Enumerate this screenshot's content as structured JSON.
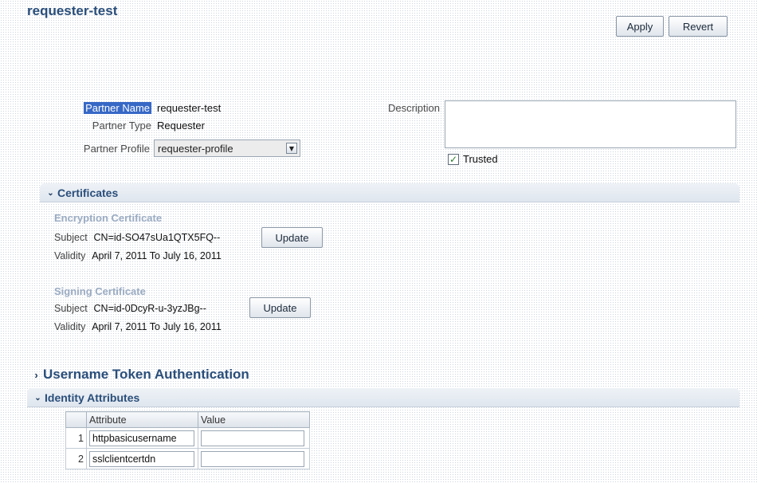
{
  "page": {
    "title": "requester-test"
  },
  "toolbar": {
    "apply_label": "Apply",
    "revert_label": "Revert"
  },
  "partner": {
    "name_label": "Partner Name",
    "name_value": "requester-test",
    "type_label": "Partner Type",
    "type_value": "Requester",
    "profile_label": "Partner Profile",
    "profile_value": "requester-profile",
    "description_label": "Description",
    "description_value": "",
    "trusted_label": "Trusted",
    "trusted_checked": true
  },
  "certificates": {
    "section_label": "Certificates",
    "expanded": true,
    "encryption": {
      "heading": "Encryption Certificate",
      "subject_label": "Subject",
      "subject_value": "CN=id-SO47sUa1QTX5FQ--",
      "validity_label": "Validity",
      "validity_value": "April 7, 2011 To July 16, 2011",
      "update_label": "Update"
    },
    "signing": {
      "heading": "Signing Certificate",
      "subject_label": "Subject",
      "subject_value": "CN=id-0DcyR-u-3yzJBg--",
      "validity_label": "Validity",
      "validity_value": "April 7, 2011 To July 16, 2011",
      "update_label": "Update"
    }
  },
  "username_token": {
    "section_label": "Username Token Authentication",
    "expanded": false
  },
  "identity": {
    "section_label": "Identity Attributes",
    "expanded": true,
    "columns": [
      "Attribute",
      "Value"
    ],
    "rows": [
      {
        "num": "1",
        "attribute": "httpbasicusername",
        "value": ""
      },
      {
        "num": "2",
        "attribute": "sslclientcertdn",
        "value": ""
      }
    ]
  },
  "colors": {
    "heading": "#2a4e7a",
    "subheading": "#9aabc2",
    "selection": "#3768c6"
  },
  "icons": {
    "expanded": "chevron-down-icon",
    "collapsed": "chevron-right-icon",
    "checkbox": "checkmark-icon",
    "dropdown": "dropdown-arrow-icon"
  }
}
